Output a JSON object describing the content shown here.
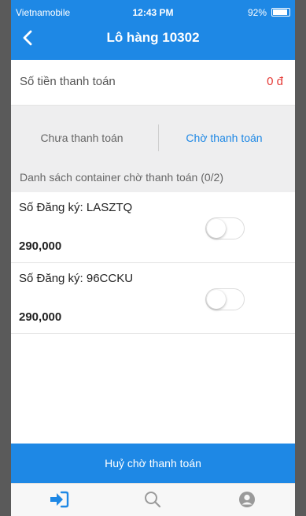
{
  "status_bar": {
    "carrier": "Vietnamobile",
    "time": "12:43 PM",
    "battery": "92%",
    "battery_level": 0.92
  },
  "nav": {
    "title": "Lô hàng 10302",
    "back_icon": "chevron-left-icon"
  },
  "payment": {
    "label": "Số tiền thanh toán",
    "amount": "0 đ"
  },
  "tabs": [
    {
      "label": "Chưa thanh toán",
      "active": false
    },
    {
      "label": "Chờ thanh toán",
      "active": true
    }
  ],
  "section": {
    "title": "Danh sách container chờ thanh toán (0/2)"
  },
  "containers": [
    {
      "registration": "Số Đăng ký: LASZTQ",
      "price": "290,000",
      "selected": false
    },
    {
      "registration": "Số Đăng ký: 96CCKU",
      "price": "290,000",
      "selected": false
    }
  ],
  "actions": {
    "cancel_label": "Huỷ chờ thanh toán"
  },
  "tabbar": [
    {
      "icon": "sign-in-icon",
      "active": true
    },
    {
      "icon": "search-icon",
      "active": false
    },
    {
      "icon": "user-icon",
      "active": false
    }
  ],
  "colors": {
    "primary": "#1E88E5",
    "amount": "#E53935",
    "background": "#EEEEEF"
  }
}
